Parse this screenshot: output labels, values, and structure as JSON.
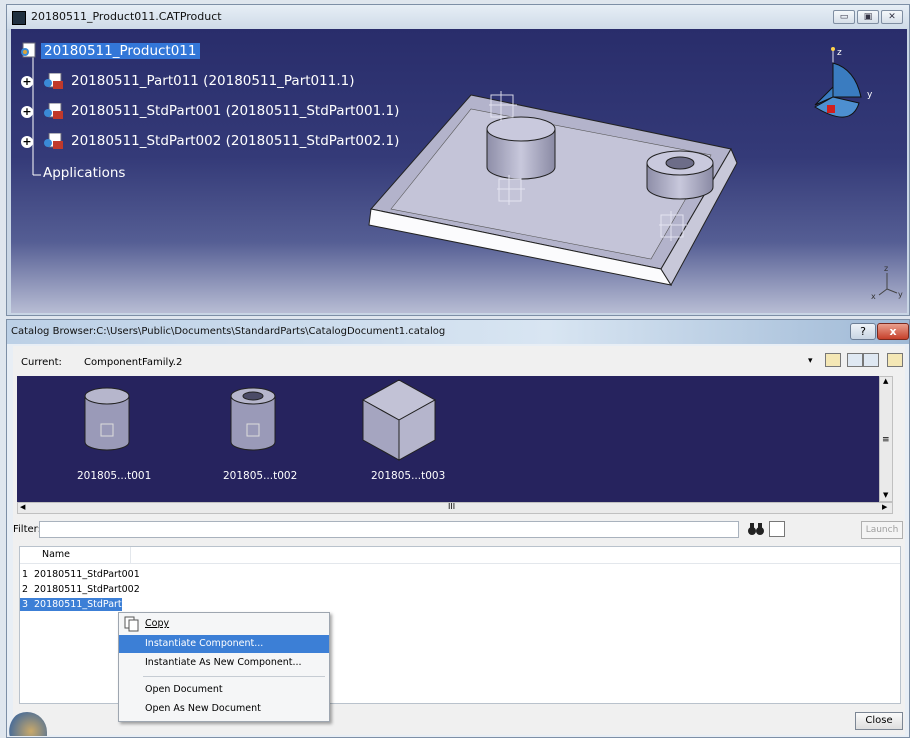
{
  "cat_window": {
    "title": "20180511_Product011.CATProduct",
    "tree": {
      "root": "20180511_Product011",
      "children": [
        "20180511_Part011 (20180511_Part011.1)",
        "20180511_StdPart001 (20180511_StdPart001.1)",
        "20180511_StdPart002 (20180511_StdPart002.1)"
      ],
      "applications": "Applications"
    },
    "compass_axes": {
      "z": "z",
      "y": "y"
    },
    "axis_labels": {
      "z": "z",
      "x": "x",
      "y": "y"
    }
  },
  "catalog_browser": {
    "title": "Catalog Browser:C:\\Users\\Public\\Documents\\StandardParts\\CatalogDocument1.catalog",
    "help": "?",
    "close_x": "x",
    "current_label": "Current:",
    "current_value": "ComponentFamily.2",
    "thumbnails": [
      {
        "caption": "201805...t001",
        "shape": "cylinder"
      },
      {
        "caption": "201805...t002",
        "shape": "hollow-cylinder"
      },
      {
        "caption": "201805...t003",
        "shape": "cube"
      }
    ],
    "hscroll_mark": "III",
    "vscroll_mark": "≡",
    "filter_label": "Filter:",
    "filter_value": "",
    "launch_label": "Launch",
    "list": {
      "column_header": "Name",
      "rows": [
        {
          "index": "1",
          "name": "20180511_StdPart001",
          "selected": false
        },
        {
          "index": "2",
          "name": "20180511_StdPart002",
          "selected": false
        },
        {
          "index": "3",
          "name": "20180511_StdPart003",
          "selected": true
        }
      ]
    },
    "close_label": "Close"
  },
  "context_menu": {
    "items": [
      {
        "label": "Copy",
        "highlighted": false
      },
      {
        "label": "Instantiate Component...",
        "highlighted": true
      },
      {
        "label": "Instantiate As New Component...",
        "highlighted": false
      },
      {
        "label": "Open Document",
        "highlighted": false
      },
      {
        "label": "Open As New Document",
        "highlighted": false
      }
    ]
  },
  "colors": {
    "viewport_bg": "#292d6b",
    "selection": "#3377d8",
    "menu_highlight": "#3c7fd6"
  }
}
